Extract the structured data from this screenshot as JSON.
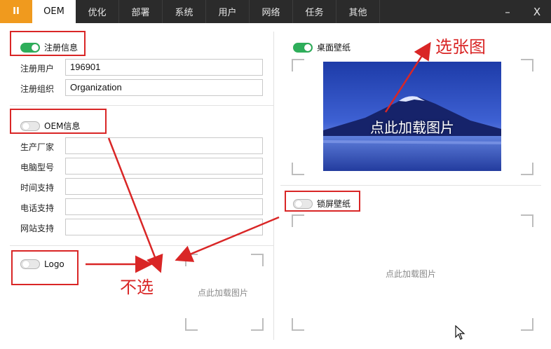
{
  "app_button": "II",
  "tabs": [
    {
      "label": "OEM",
      "active": true
    },
    {
      "label": "优化"
    },
    {
      "label": "部署"
    },
    {
      "label": "系统"
    },
    {
      "label": "用户"
    },
    {
      "label": "网络"
    },
    {
      "label": "任务"
    },
    {
      "label": "其他"
    }
  ],
  "window": {
    "minimize": "–",
    "close": "X"
  },
  "registration": {
    "toggle_label": "注册信息",
    "enabled": true,
    "user_label": "注册用户",
    "user_value": "196901",
    "org_label": "注册组织",
    "org_value": "Organization"
  },
  "oem": {
    "toggle_label": "OEM信息",
    "enabled": false,
    "fields": [
      {
        "label": "生产厂家",
        "value": ""
      },
      {
        "label": "电脑型号",
        "value": ""
      },
      {
        "label": "时间支持",
        "value": ""
      },
      {
        "label": "电话支持",
        "value": ""
      },
      {
        "label": "网站支持",
        "value": ""
      }
    ]
  },
  "logo": {
    "toggle_label": "Logo",
    "enabled": false,
    "hint": "点此加载图片"
  },
  "desktop_wallpaper": {
    "toggle_label": "桌面壁纸",
    "enabled": true,
    "hint": "点此加载图片"
  },
  "lock_wallpaper": {
    "toggle_label": "锁屏壁纸",
    "enabled": false,
    "hint": "点此加载图片"
  },
  "annotations": {
    "select_image": "选张图",
    "dont_select": "不选"
  },
  "colors": {
    "accent": "#f09a1e",
    "titlebar": "#2b2b2b",
    "toggle_on": "#2eae5a",
    "annotation": "#d92626"
  }
}
